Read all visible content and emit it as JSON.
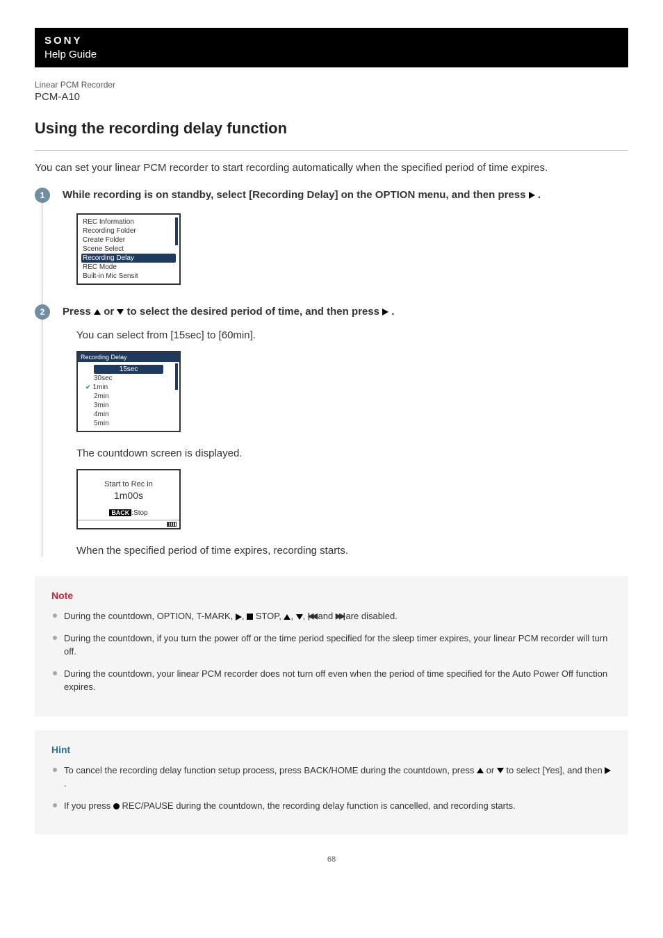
{
  "header": {
    "brand": "SONY",
    "help_guide": "Help Guide",
    "product_label": "Linear PCM Recorder",
    "model": "PCM-A10"
  },
  "page_title": "Using the recording delay function",
  "intro": "You can set your linear PCM recorder to start recording automatically when the specified period of time expires.",
  "steps": [
    {
      "num": "1",
      "title_pre": "While recording is on standby, select [Recording Delay] on the OPTION menu, and then press ",
      "title_post": " .",
      "screen_items": [
        "REC Information",
        "Recording Folder",
        "Create Folder",
        "Scene Select",
        "Recording Delay",
        "REC Mode",
        "Built-in Mic Sensit"
      ],
      "highlight_index": 4
    },
    {
      "num": "2",
      "title_pre": "Press ",
      "title_mid": " or ",
      "title_mid2": " to select the desired period of time, and then press ",
      "title_post": " .",
      "body_line1": "You can select from [15sec] to [60min].",
      "screen_title": "Recording Delay",
      "options": [
        "15sec",
        "30sec",
        "1min",
        "2min",
        "3min",
        "4min",
        "5min"
      ],
      "option_highlight": 0,
      "option_checked": 2,
      "body_line2": "The countdown screen is displayed.",
      "countdown": {
        "l1": "Start to Rec in",
        "l2": "1m00s",
        "back_label": "BACK",
        "stop_label": ":Stop"
      },
      "body_line3": "When the specified period of time expires, recording starts."
    }
  ],
  "note": {
    "title": "Note",
    "items": [
      {
        "pre": "During the countdown, OPTION, T-MARK, ",
        "mid1": ", ",
        "stop_label": "STOP, ",
        "mid2": ", ",
        "mid3": ", ",
        "mid4": " and ",
        "post": " are disabled."
      },
      {
        "text": "During the countdown, if you turn the power off or the time period specified for the sleep timer expires, your linear PCM recorder will turn off."
      },
      {
        "text": "During the countdown, your linear PCM recorder does not turn off even when the period of time specified for the Auto Power Off function expires."
      }
    ]
  },
  "hint": {
    "title": "Hint",
    "items": [
      {
        "pre": "To cancel the recording delay function setup process, press BACK/HOME during the countdown, press ",
        "mid": " or ",
        "mid2": " to select [Yes], and then ",
        "post": "."
      },
      {
        "pre": "If you press ",
        "rec_label": "REC/PAUSE during the countdown, the recording delay function is cancelled, and recording starts."
      }
    ]
  },
  "page_num": "68"
}
